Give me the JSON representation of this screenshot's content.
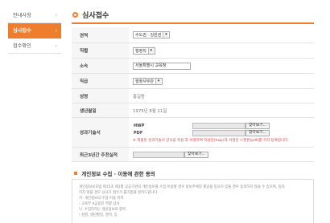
{
  "sidebar": {
    "items": [
      {
        "label": "안내사항",
        "active": false
      },
      {
        "label": "심사접수",
        "active": true
      },
      {
        "label": "접수확인",
        "active": false
      }
    ],
    "chevron": "›"
  },
  "page": {
    "title": "심사접수"
  },
  "form": {
    "region": {
      "label": "권역",
      "value": "수도권 · 강원권"
    },
    "position": {
      "label": "직렬",
      "value": "행정직"
    },
    "affiliation": {
      "label": "소속",
      "value": "서울특별시 교육청"
    },
    "grade": {
      "label": "직급",
      "value": "행정사무관"
    },
    "name": {
      "label": "성명",
      "value": "홍길동"
    },
    "birth": {
      "label": "생년월일",
      "value": "1975년 8월 11일"
    },
    "merit": {
      "label": "성과기술서",
      "hwp_label": "HWP",
      "pdf_label": "PDF",
      "browse_label": "찾아보기...",
      "note": "※ 제출된 성과기술서 양식을 작성 후 서명하여 작성된(hwp)과 서명한 스캔본(pdf)를 각각 등록합니다."
    },
    "recommend": {
      "label": "최근3년간 추천실적",
      "browse_label": "찾아보기..."
    }
  },
  "consent": {
    "title": "개인정보 수집 · 이용에 관한 동의",
    "lines": [
      "개인정보보호법 제15조 제1항 공공기관의 개인정보를 수집·이용할 경우 정보주체의 제공을 동의가 있을 경우 동의하지 않을 수 있으며, 동의",
      "하지 않을 경우 심사가 접수가 불가함을 알려드립니다.",
      "가. 개인정보의 수집·이용 목적",
      "  - 교육부 4급승진 역량 심사",
      "나. 수집하려는 개인정보의 항목",
      "  - 성명, 생년월일, 경력, 등"
    ]
  },
  "colors": {
    "accent": "#ee7d2e",
    "note": "#e0454a"
  }
}
